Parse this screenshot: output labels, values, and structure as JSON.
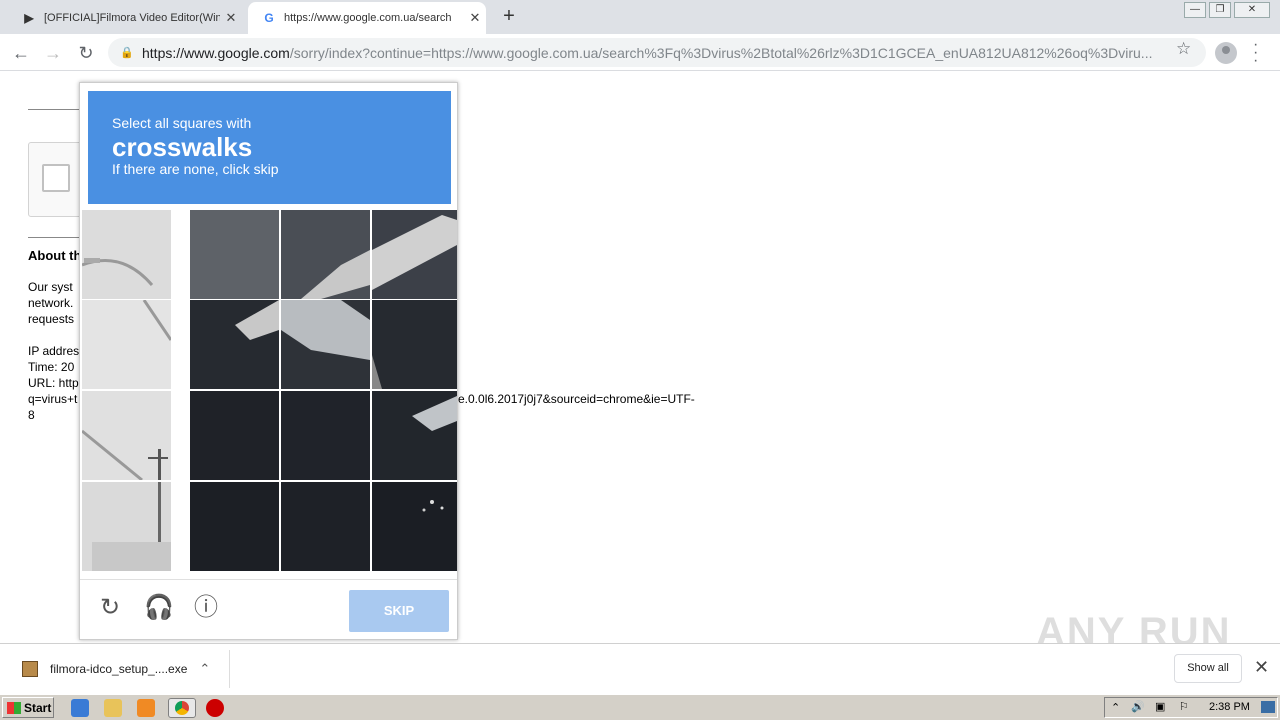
{
  "browser": {
    "tabs": [
      {
        "title": "[OFFICIAL]Filmora Video Editor(Wind",
        "active": false
      },
      {
        "title": "https://www.google.com.ua/search",
        "active": true
      }
    ],
    "url_host": "https://www.google.com",
    "url_rest": "/sorry/index?continue=https://www.google.com.ua/search%3Fq%3Dvirus%2Btotal%26rlz%3D1C1GCEA_enUA812UA812%26oq%3Dviru..."
  },
  "page": {
    "about_heading": "About th",
    "lines": [
      "Our syst",
      "network.",
      "requests",
      "",
      "IP addres",
      "Time: 20",
      "URL: http",
      "q=virus+t",
      "8"
    ],
    "url_tail": "e.0.0l6.2017j0j7&sourceid=chrome&ie=UTF-"
  },
  "captcha": {
    "line1": "Select all squares with",
    "keyword": "crosswalks",
    "line3": "If there are none, click skip",
    "skip_label": "SKIP"
  },
  "downloads": {
    "file_name": "filmora-idco_setup_....exe",
    "show_all": "Show all"
  },
  "watermark": "ANY RUN",
  "taskbar": {
    "start_label": "Start",
    "clock": "2:38 PM"
  },
  "colors": {
    "captcha_header": "#4a90e2",
    "skip_disabled": "#a9c9f0"
  }
}
